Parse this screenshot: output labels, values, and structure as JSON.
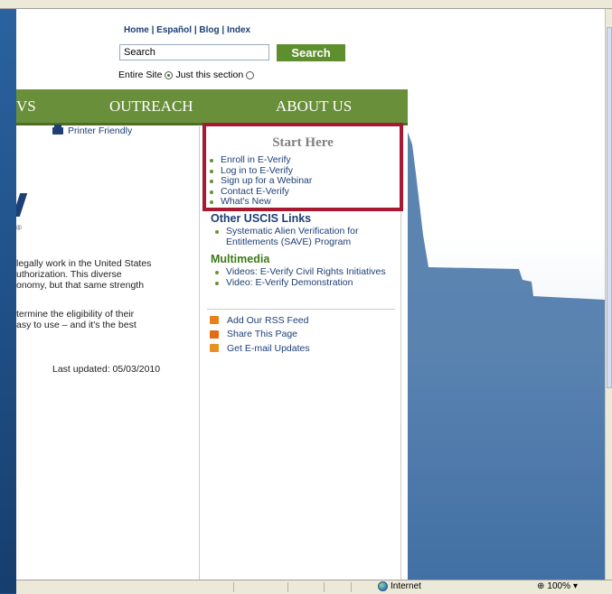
{
  "header": {
    "links": [
      "Home",
      "Español",
      "Blog",
      "Index"
    ],
    "separator": " | ",
    "search_placeholder": "Search",
    "search_button": "Search",
    "scope_label_1": "Entire Site",
    "scope_label_2": "Just this section",
    "scope_selected": "Entire Site"
  },
  "nav": {
    "news": "VS",
    "outreach": "OUTREACH",
    "about": "ABOUT US"
  },
  "content": {
    "printer_friendly": "Printer Friendly",
    "reg_mark": "®",
    "paragraph1": [
      "legally work in the United States",
      "uthorization. This diverse",
      "onomy, but that same strength"
    ],
    "paragraph2": [
      "termine the eligibility of their",
      "asy to use – and it's the best"
    ],
    "last_updated": "Last updated: 05/03/2010"
  },
  "sidebar": {
    "start_title": "Start Here",
    "start_links": [
      "Enroll in E-Verify",
      "Log in to E-Verify",
      "Sign up for a Webinar",
      "Contact E-Verify",
      "What's New"
    ],
    "other_title": "Other USCIS Links",
    "other_links": [
      "Systematic Alien Verification for Entitlements (SAVE) Program"
    ],
    "multimedia_title": "Multimedia",
    "multimedia_links": [
      "Videos: E-Verify Civil Rights Initiatives",
      "Video: E-Verify Demonstration"
    ],
    "share_links": [
      "Add Our RSS Feed",
      "Share This Page",
      "Get E-mail Updates"
    ]
  },
  "statusbar": {
    "zone": "Internet",
    "zoom": "100%"
  },
  "colors": {
    "nav_green": "#6a8f3a",
    "link_blue": "#1d3f75",
    "highlight_red": "#a71930",
    "desktop_blue": "#1d4f86"
  }
}
